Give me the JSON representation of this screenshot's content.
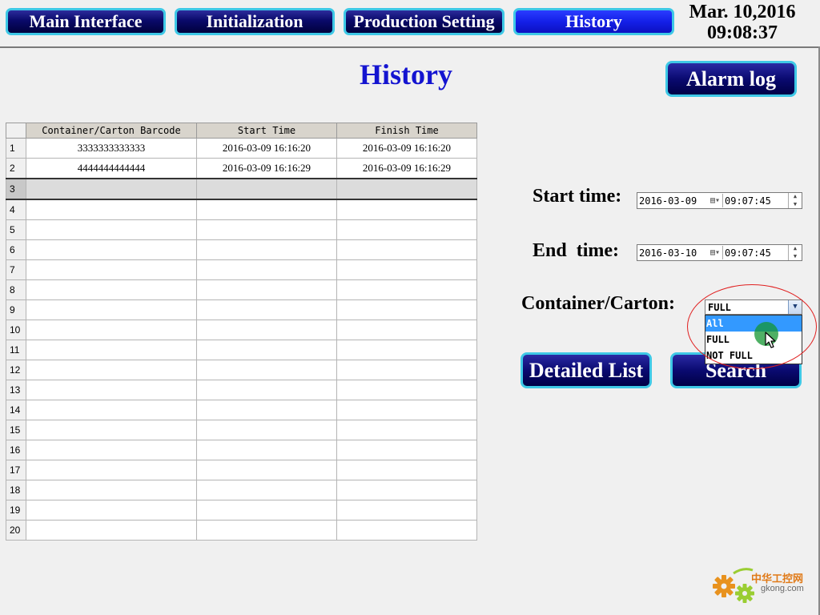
{
  "nav": {
    "main_interface": "Main Interface",
    "initialization": "Initialization",
    "production_setting": "Production Setting",
    "history": "History"
  },
  "clock": {
    "date": "Mar. 10,2016",
    "time": "09:08:37"
  },
  "page_title": "History",
  "alarm_log_button": "Alarm log",
  "table": {
    "headers": [
      "Container/Carton Barcode",
      "Start Time",
      "Finish Time"
    ],
    "rows": [
      {
        "n": "1",
        "barcode": "3333333333333",
        "start": "2016-03-09 16:16:20",
        "finish": "2016-03-09 16:16:20"
      },
      {
        "n": "2",
        "barcode": "4444444444444",
        "start": "2016-03-09 16:16:29",
        "finish": "2016-03-09 16:16:29"
      },
      {
        "n": "3",
        "barcode": "",
        "start": "",
        "finish": ""
      },
      {
        "n": "4",
        "barcode": "",
        "start": "",
        "finish": ""
      },
      {
        "n": "5",
        "barcode": "",
        "start": "",
        "finish": ""
      },
      {
        "n": "6",
        "barcode": "",
        "start": "",
        "finish": ""
      },
      {
        "n": "7",
        "barcode": "",
        "start": "",
        "finish": ""
      },
      {
        "n": "8",
        "barcode": "",
        "start": "",
        "finish": ""
      },
      {
        "n": "9",
        "barcode": "",
        "start": "",
        "finish": ""
      },
      {
        "n": "10",
        "barcode": "",
        "start": "",
        "finish": ""
      },
      {
        "n": "11",
        "barcode": "",
        "start": "",
        "finish": ""
      },
      {
        "n": "12",
        "barcode": "",
        "start": "",
        "finish": ""
      },
      {
        "n": "13",
        "barcode": "",
        "start": "",
        "finish": ""
      },
      {
        "n": "14",
        "barcode": "",
        "start": "",
        "finish": ""
      },
      {
        "n": "15",
        "barcode": "",
        "start": "",
        "finish": ""
      },
      {
        "n": "16",
        "barcode": "",
        "start": "",
        "finish": ""
      },
      {
        "n": "17",
        "barcode": "",
        "start": "",
        "finish": ""
      },
      {
        "n": "18",
        "barcode": "",
        "start": "",
        "finish": ""
      },
      {
        "n": "19",
        "barcode": "",
        "start": "",
        "finish": ""
      },
      {
        "n": "20",
        "barcode": "",
        "start": "",
        "finish": ""
      }
    ],
    "selected_row": "3"
  },
  "filters": {
    "start_label": "Start time:",
    "start_date": "2016-03-09",
    "start_time": "09:07:45",
    "end_label": "End  time:",
    "end_date": "2016-03-10",
    "end_time": "09:07:45",
    "container_label": "Container/Carton:",
    "container_value": "FULL",
    "container_options": [
      "All",
      "FULL",
      "NOT FULL"
    ],
    "highlighted_option": "All"
  },
  "detailed_list_button": "Detailed List",
  "search_button": "Search",
  "watermark": {
    "brand": "中华工控网",
    "site": "gkong.com"
  },
  "colors": {
    "accent_border": "#3ec8e6",
    "title_blue": "#1414d0",
    "highlight": "#3399ff"
  }
}
